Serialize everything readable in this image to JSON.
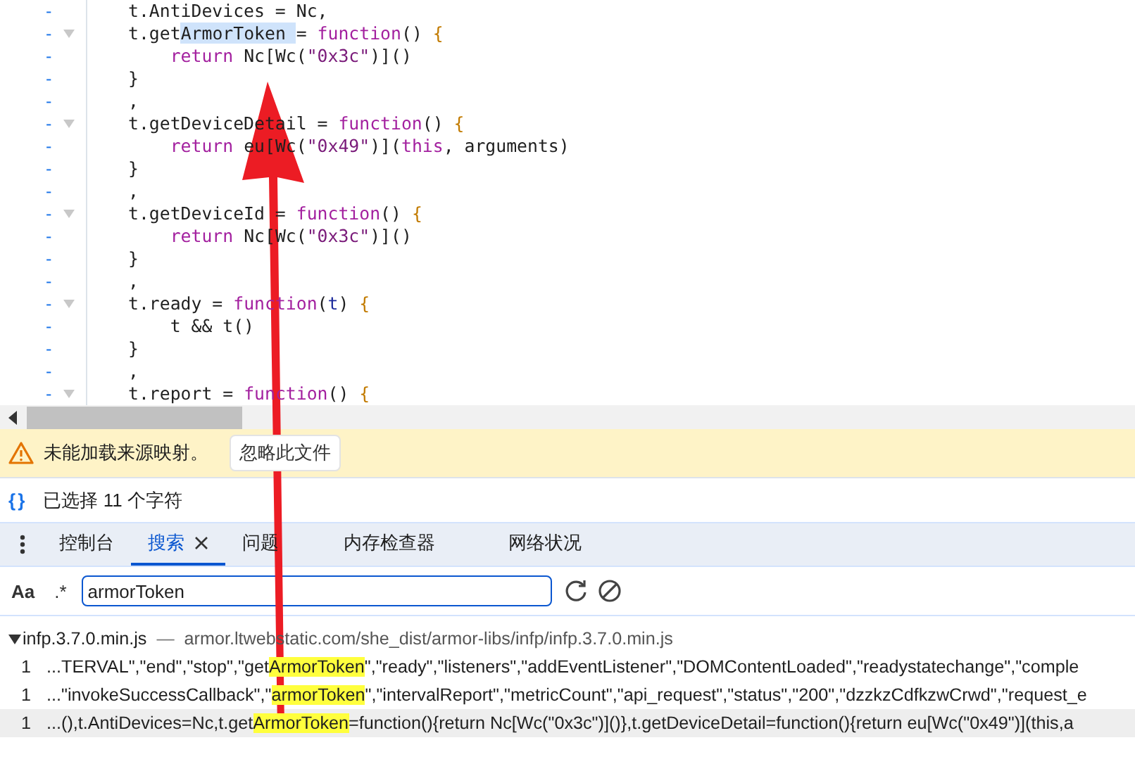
{
  "editor": {
    "lines": [
      {
        "fold": false,
        "segments": [
          {
            "text": "t.AntiDevices = Nc,",
            "kind": "plain"
          }
        ]
      },
      {
        "fold": true,
        "segments": [
          {
            "text": "t.get",
            "kind": "plain"
          },
          {
            "text": "ArmorToken ",
            "kind": "selected"
          },
          {
            "text": "= ",
            "kind": "plain"
          },
          {
            "text": "function",
            "kind": "keyword"
          },
          {
            "text": "() ",
            "kind": "plain"
          },
          {
            "text": "{",
            "kind": "brace"
          }
        ]
      },
      {
        "fold": false,
        "segments": [
          {
            "text": "    return",
            "kind": "keyword"
          },
          {
            "text": " Nc[Wc(",
            "kind": "plain"
          },
          {
            "text": "\"0x3c\"",
            "kind": "string"
          },
          {
            "text": ")]()",
            "kind": "plain"
          }
        ]
      },
      {
        "fold": false,
        "segments": [
          {
            "text": "}",
            "kind": "plain"
          }
        ]
      },
      {
        "fold": false,
        "segments": [
          {
            "text": ",",
            "kind": "plain"
          }
        ]
      },
      {
        "fold": true,
        "segments": [
          {
            "text": "t.getDeviceDetail = ",
            "kind": "plain"
          },
          {
            "text": "function",
            "kind": "keyword"
          },
          {
            "text": "() ",
            "kind": "plain"
          },
          {
            "text": "{",
            "kind": "brace"
          }
        ]
      },
      {
        "fold": false,
        "segments": [
          {
            "text": "    return",
            "kind": "keyword"
          },
          {
            "text": " eu[Wc(",
            "kind": "plain"
          },
          {
            "text": "\"0x49\"",
            "kind": "string"
          },
          {
            "text": ")](",
            "kind": "plain"
          },
          {
            "text": "this",
            "kind": "keyword"
          },
          {
            "text": ", arguments)",
            "kind": "plain"
          }
        ]
      },
      {
        "fold": false,
        "segments": [
          {
            "text": "}",
            "kind": "plain"
          }
        ]
      },
      {
        "fold": false,
        "segments": [
          {
            "text": ",",
            "kind": "plain"
          }
        ]
      },
      {
        "fold": true,
        "segments": [
          {
            "text": "t.getDeviceId = ",
            "kind": "plain"
          },
          {
            "text": "function",
            "kind": "keyword"
          },
          {
            "text": "() ",
            "kind": "plain"
          },
          {
            "text": "{",
            "kind": "brace"
          }
        ]
      },
      {
        "fold": false,
        "segments": [
          {
            "text": "    return",
            "kind": "keyword"
          },
          {
            "text": " Nc[Wc(",
            "kind": "plain"
          },
          {
            "text": "\"0x3c\"",
            "kind": "string"
          },
          {
            "text": ")]()",
            "kind": "plain"
          }
        ]
      },
      {
        "fold": false,
        "segments": [
          {
            "text": "}",
            "kind": "plain"
          }
        ]
      },
      {
        "fold": false,
        "segments": [
          {
            "text": ",",
            "kind": "plain"
          }
        ]
      },
      {
        "fold": true,
        "segments": [
          {
            "text": "t.ready = ",
            "kind": "plain"
          },
          {
            "text": "function",
            "kind": "keyword"
          },
          {
            "text": "(",
            "kind": "plain"
          },
          {
            "text": "t",
            "kind": "param"
          },
          {
            "text": ") ",
            "kind": "plain"
          },
          {
            "text": "{",
            "kind": "brace"
          }
        ]
      },
      {
        "fold": false,
        "segments": [
          {
            "text": "    t && t()",
            "kind": "plain"
          }
        ]
      },
      {
        "fold": false,
        "segments": [
          {
            "text": "}",
            "kind": "plain"
          }
        ]
      },
      {
        "fold": false,
        "segments": [
          {
            "text": ",",
            "kind": "plain"
          }
        ]
      },
      {
        "fold": true,
        "segments": [
          {
            "text": "t.report = ",
            "kind": "plain"
          },
          {
            "text": "function",
            "kind": "keyword"
          },
          {
            "text": "() ",
            "kind": "plain"
          },
          {
            "text": "{",
            "kind": "brace"
          }
        ]
      }
    ],
    "gutter_mark": "-"
  },
  "warning": {
    "message": "未能加载来源映射。",
    "button": "忽略此文件"
  },
  "status": {
    "icon_text": "{ }",
    "text": "已选择 11 个字符"
  },
  "tabs": [
    {
      "label": "控制台",
      "selected": false,
      "closable": false
    },
    {
      "label": "搜索",
      "selected": true,
      "closable": true
    },
    {
      "label": "问题",
      "selected": false,
      "closable": false
    },
    {
      "label": "内存检查器",
      "selected": false,
      "closable": false
    },
    {
      "label": "网络状况",
      "selected": false,
      "closable": false
    }
  ],
  "search": {
    "case_toggle": "Aa",
    "regex_toggle": ".*",
    "value": "armorToken"
  },
  "results": {
    "file": "infp.3.7.0.min.js",
    "separator": "—",
    "url": "armor.ltwebstatic.com/she_dist/armor-libs/infp/infp.3.7.0.min.js",
    "expanded": true,
    "rows": [
      {
        "line": "1",
        "selected": false,
        "segments": [
          {
            "text": "...TERVAL\",\"end\",\"stop\",\"get",
            "match": false
          },
          {
            "text": "ArmorToken",
            "match": true
          },
          {
            "text": "\",\"ready\",\"listeners\",\"addEventListener\",\"DOMContentLoaded\",\"readystatechange\",\"comple",
            "match": false
          }
        ]
      },
      {
        "line": "1",
        "selected": false,
        "segments": [
          {
            "text": "...\"invokeSuccessCallback\",\"",
            "match": false
          },
          {
            "text": "armorToken",
            "match": true
          },
          {
            "text": "\",\"intervalReport\",\"metricCount\",\"api_request\",\"status\",\"200\",\"dzzkzCdfkzwCrwd\",\"request_e",
            "match": false
          }
        ]
      },
      {
        "line": "1",
        "selected": true,
        "segments": [
          {
            "text": "...(),t.AntiDevices=Nc,t.get",
            "match": false
          },
          {
            "text": "ArmorToken",
            "match": true
          },
          {
            "text": "=function(){return Nc[Wc(\"0x3c\")]()},t.getDeviceDetail=function(){return eu[Wc(\"0x49\")](this,a",
            "match": false
          }
        ]
      }
    ]
  },
  "annotations": [
    {
      "kind": "arrow"
    }
  ]
}
